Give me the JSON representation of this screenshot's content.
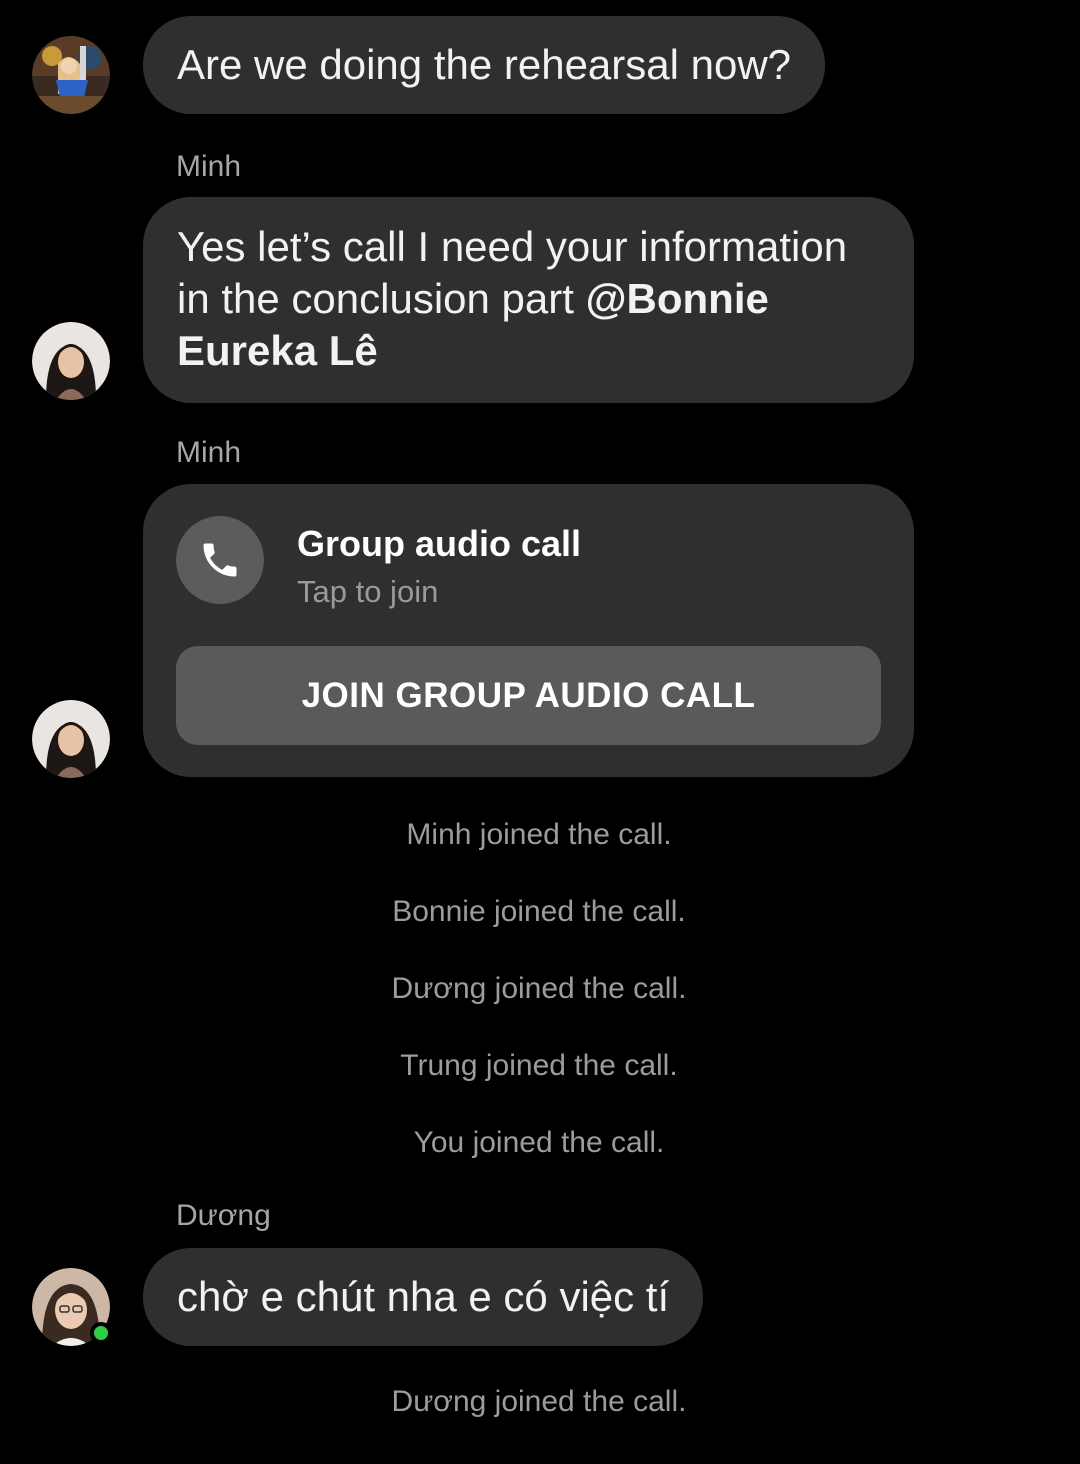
{
  "messages": [
    {
      "avatar_icon": "avatar-anime-icon",
      "text": "Are we doing the rehearsal now?"
    },
    {
      "sender": "Minh",
      "avatar_icon": "avatar-minh-icon",
      "text_plain": "Yes let’s call I need your information in the conclusion part ",
      "mention": "@Bonnie Eureka Lê"
    },
    {
      "sender": "Minh",
      "avatar_icon": "avatar-minh-icon",
      "call": {
        "icon": "phone-icon",
        "title": "Group audio call",
        "subtitle": "Tap to join",
        "button_label": "JOIN GROUP AUDIO CALL"
      }
    },
    {
      "sender": "Dương",
      "avatar_icon": "avatar-duong-icon",
      "online": true,
      "text": "chờ e chút nha e có việc tí"
    }
  ],
  "events": [
    "Minh joined the call.",
    "Bonnie joined the call.",
    "Dương joined the call.",
    "Trung joined the call.",
    "You joined the call.",
    "Dương joined the call."
  ],
  "colors": {
    "background": "#000000",
    "bubble": "#2f2f2f",
    "button": "#5a5a5a",
    "online": "#31cc46",
    "muted_text": "#9c9c9c"
  }
}
